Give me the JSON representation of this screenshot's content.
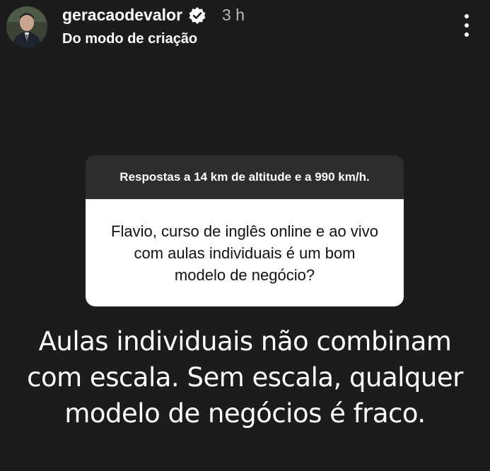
{
  "header": {
    "username": "geracaodevalor",
    "timestamp": "3 h",
    "subtitle": "Do modo de criação",
    "verified_badge_icon": "verified-badge-icon",
    "more_icon": "more-vertical-icon"
  },
  "question_card": {
    "header_text": "Respostas a 14 km de altitude e a 990 km/h.",
    "question_text": "Flavio, curso de inglês online e ao vivo com aulas individuais é um bom modelo de negócio?"
  },
  "answer": {
    "text": "Aulas individuais não combinam com escala. Sem escala, qualquer modelo de negócios é fraco."
  },
  "colors": {
    "background": "#1c1c1c",
    "card_header": "#2e2e2e",
    "card_body": "#ffffff",
    "text_primary": "#ffffff",
    "text_secondary": "#b9b9b9"
  }
}
